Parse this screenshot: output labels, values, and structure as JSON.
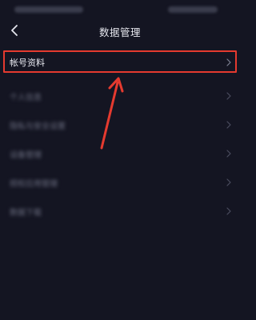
{
  "header": {
    "title": "数据管理",
    "back_icon": "chevron-left-icon"
  },
  "items": [
    {
      "label": "帐号资料",
      "readable": true
    },
    {
      "label": "个人信息",
      "readable": false
    },
    {
      "label": "隐私与安全设置",
      "readable": false
    },
    {
      "label": "设备管理",
      "readable": false
    },
    {
      "label": "授权应用管理",
      "readable": false
    },
    {
      "label": "数据下载",
      "readable": false
    }
  ],
  "colors": {
    "background": "#141522",
    "highlight": "#e53a2f",
    "text": "#e8e9f0"
  }
}
